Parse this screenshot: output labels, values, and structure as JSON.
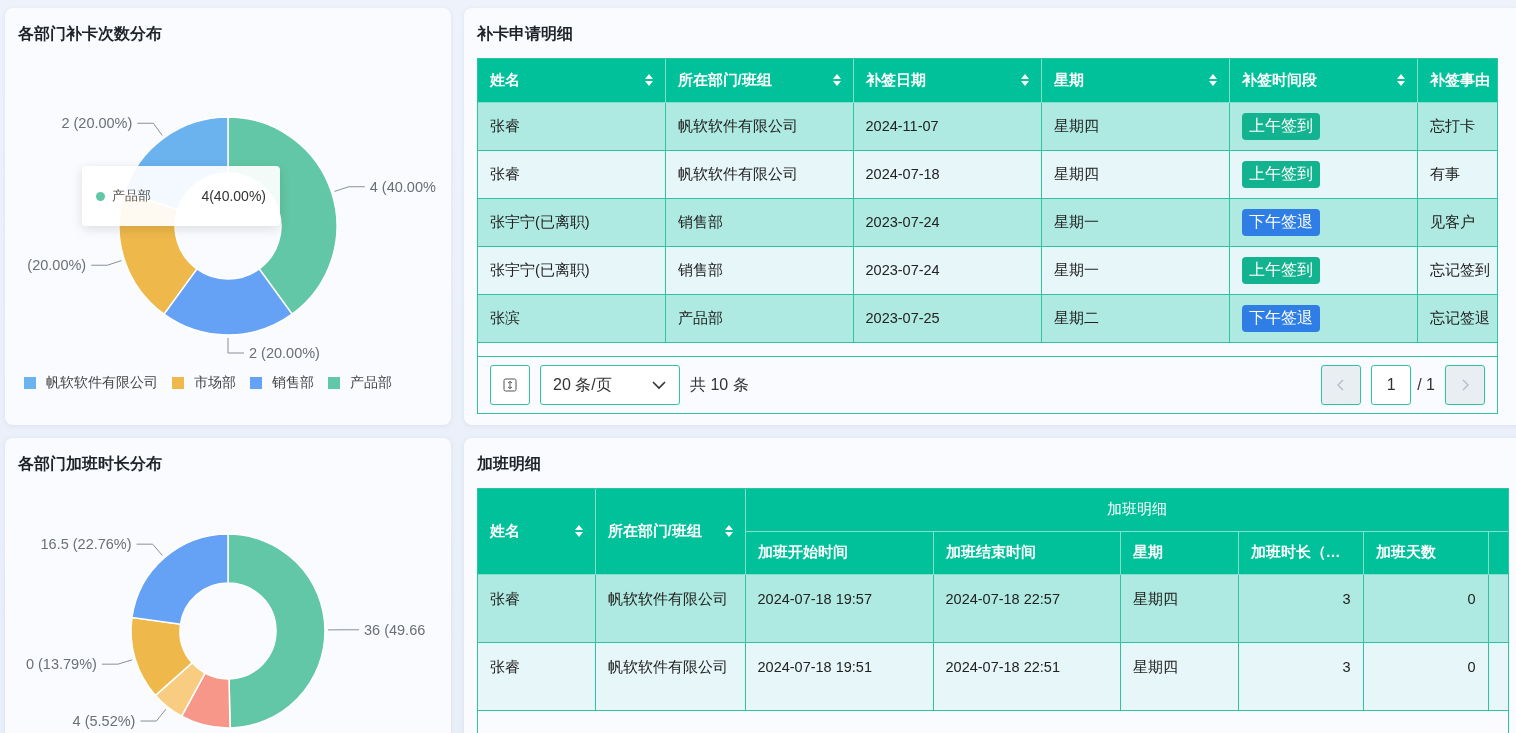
{
  "charts": [
    {
      "title": "各部门补卡次数分布",
      "chart_data": {
        "type": "donut",
        "values": [
          40,
          20,
          20,
          20
        ]
      },
      "slices": [
        {
          "color": "#62c7a6",
          "label": "4 (40.00%"
        },
        {
          "color": "#65a1f5",
          "label": "2 (20.00%)"
        },
        {
          "color": "#eeb84b",
          "label": "(20.00%)"
        },
        {
          "color": "#6ab3ef",
          "label": "2 (20.00%)"
        }
      ],
      "tooltip": {
        "name": "产品部",
        "value": "4(40.00%)",
        "color": "#62c7a6"
      },
      "legend": [
        {
          "label": "帆软软件有限公司",
          "color": "#6ab3ef"
        },
        {
          "label": "市场部",
          "color": "#eeb84b"
        },
        {
          "label": "销售部",
          "color": "#65a1f5"
        },
        {
          "label": "产品部",
          "color": "#62c7a6"
        }
      ]
    },
    {
      "title": "各部门加班时长分布",
      "chart_data": {
        "type": "donut",
        "values": [
          49.66,
          8.27,
          5.52,
          13.79,
          22.76
        ]
      },
      "slices": [
        {
          "color": "#62c7a6",
          "label": "36 (49.66"
        },
        {
          "color": "#f7978a"
        },
        {
          "color": "#f8cd82",
          "label": "4 (5.52%)"
        },
        {
          "color": "#eeb84b",
          "label": "0 (13.79%)"
        },
        {
          "color": "#65a1f5",
          "label": "16.5 (22.76%)"
        }
      ]
    }
  ],
  "attendance_table": {
    "title": "补卡申请明细",
    "columns": [
      {
        "label": "姓名",
        "sortable": true
      },
      {
        "label": "所在部门/班组",
        "sortable": true
      },
      {
        "label": "补签日期",
        "sortable": true
      },
      {
        "label": "星期",
        "sortable": true
      },
      {
        "label": "补签时间段",
        "sortable": true
      },
      {
        "label": "补签事由"
      }
    ],
    "rows": [
      {
        "name": "张睿",
        "department": "帆软软件有限公司",
        "date": "2024-11-07",
        "weekday": "星期四",
        "period": {
          "text": "上午签到",
          "kind": "in"
        },
        "reason": "忘打卡"
      },
      {
        "name": "张睿",
        "department": "帆软软件有限公司",
        "date": "2024-07-18",
        "weekday": "星期四",
        "period": {
          "text": "上午签到",
          "kind": "in"
        },
        "reason": "有事"
      },
      {
        "name": "张宇宁(已离职)",
        "department": "销售部",
        "date": "2023-07-24",
        "weekday": "星期一",
        "period": {
          "text": "下午签退",
          "kind": "out"
        },
        "reason": "见客户"
      },
      {
        "name": "张宇宁(已离职)",
        "department": "销售部",
        "date": "2023-07-24",
        "weekday": "星期一",
        "period": {
          "text": "上午签到",
          "kind": "in"
        },
        "reason": "忘记签到"
      },
      {
        "name": "张滨",
        "department": "产品部",
        "date": "2023-07-25",
        "weekday": "星期二",
        "period": {
          "text": "下午签退",
          "kind": "out"
        },
        "reason": "忘记签退"
      }
    ],
    "pagination": {
      "page_size": "20 条/页",
      "total": "共 10 条",
      "page": "1",
      "pages": "/ 1",
      "prev_disabled": true,
      "next_disabled": true
    }
  },
  "overtime_table": {
    "title": "加班明细",
    "columns": [
      {
        "label": "姓名",
        "sortable": true
      },
      {
        "label": "所在部门/班组",
        "sortable": true
      }
    ],
    "group": {
      "label": "加班明细",
      "columns": [
        "加班开始时间",
        "加班结束时间",
        "星期",
        "加班时长（…",
        "加班天数"
      ]
    },
    "rows": [
      {
        "cells": [
          "张睿",
          "帆软软件有限公司",
          "2024-07-18 19:57",
          "2024-07-18 22:57",
          "星期四",
          "3",
          "0"
        ]
      },
      {
        "cells": [
          "张睿",
          "帆软软件有限公司",
          "2024-07-18 19:51",
          "2024-07-18 22:51",
          "星期四",
          "3",
          "0"
        ]
      }
    ]
  }
}
